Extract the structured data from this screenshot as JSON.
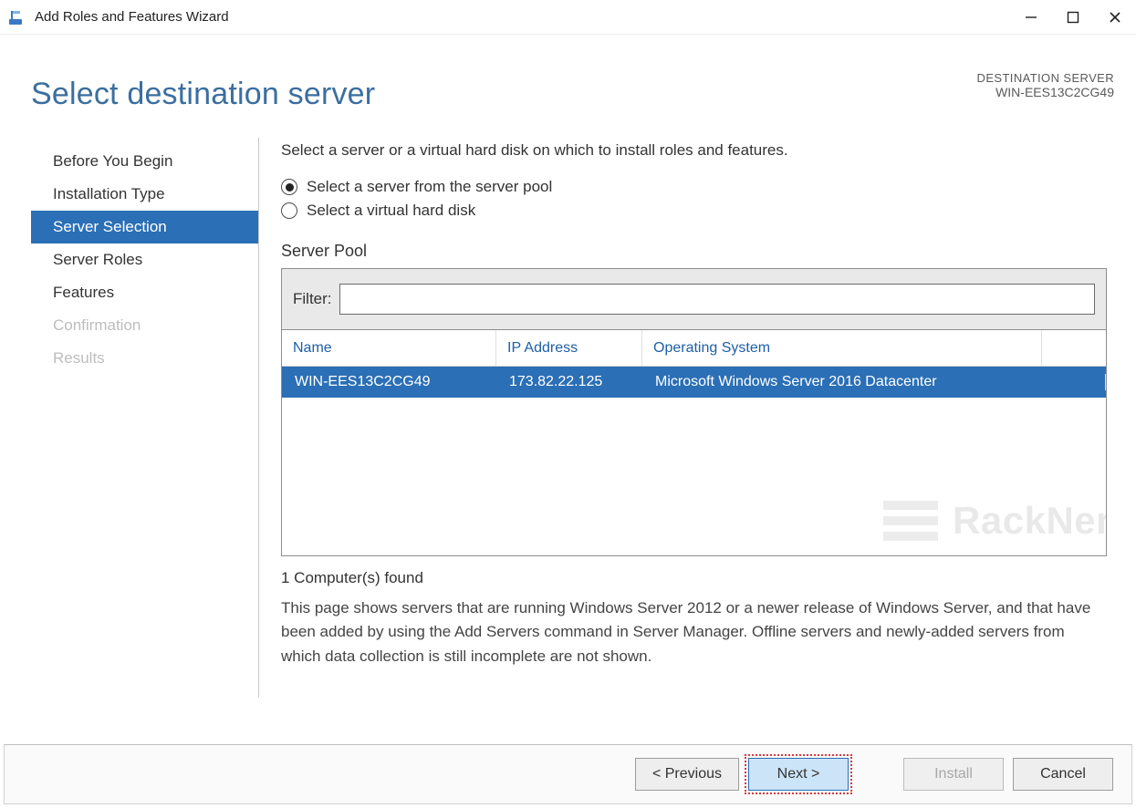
{
  "window": {
    "title": "Add Roles and Features Wizard"
  },
  "header": {
    "page_title": "Select destination server",
    "dest_label": "DESTINATION SERVER",
    "dest_value": "WIN-EES13C2CG49"
  },
  "sidebar": {
    "items": [
      {
        "label": "Before You Begin",
        "state": "normal"
      },
      {
        "label": "Installation Type",
        "state": "normal"
      },
      {
        "label": "Server Selection",
        "state": "active"
      },
      {
        "label": "Server Roles",
        "state": "normal"
      },
      {
        "label": "Features",
        "state": "normal"
      },
      {
        "label": "Confirmation",
        "state": "disabled"
      },
      {
        "label": "Results",
        "state": "disabled"
      }
    ]
  },
  "main": {
    "instruction": "Select a server or a virtual hard disk on which to install roles and features.",
    "radios": {
      "pool": "Select a server from the server pool",
      "vhd": "Select a virtual hard disk"
    },
    "section_title": "Server Pool",
    "filter_label": "Filter:",
    "filter_value": "",
    "columns": {
      "name": "Name",
      "ip": "IP Address",
      "os": "Operating System"
    },
    "rows": [
      {
        "name": "WIN-EES13C2CG49",
        "ip": "173.82.22.125",
        "os": "Microsoft Windows Server 2016 Datacenter"
      }
    ],
    "count_text": "1 Computer(s) found",
    "description": "This page shows servers that are running Windows Server 2012 or a newer release of Windows Server, and that have been added by using the Add Servers command in Server Manager. Offline servers and newly-added servers from which data collection is still incomplete are not shown."
  },
  "footer": {
    "previous": "< Previous",
    "next": "Next >",
    "install": "Install",
    "cancel": "Cancel"
  },
  "watermark": "RackNer"
}
